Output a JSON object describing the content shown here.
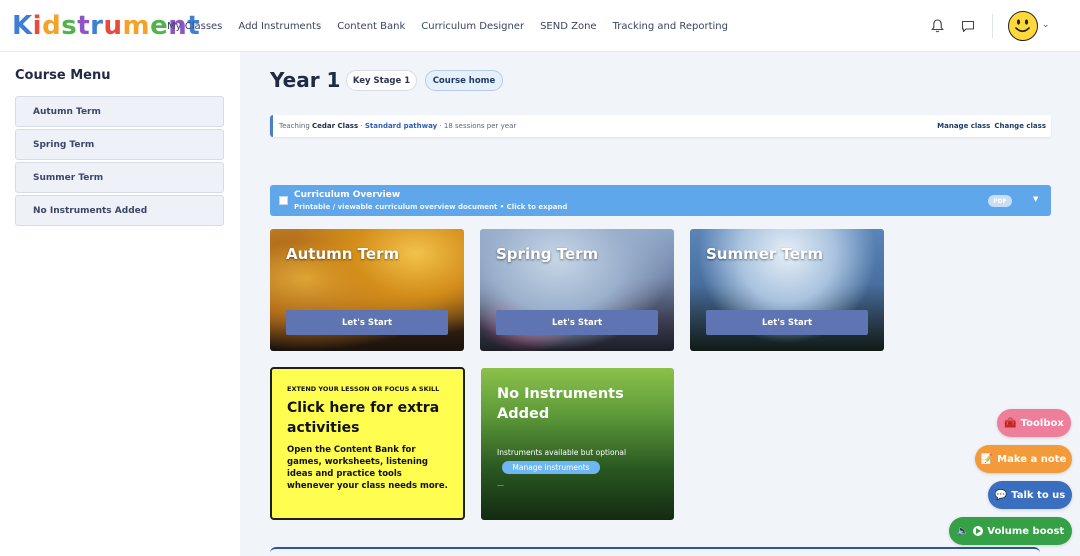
{
  "brand": {
    "logo_letters": [
      "K",
      "i",
      "d",
      "s",
      "t",
      "r",
      "u",
      "m",
      "e",
      "n",
      "t"
    ],
    "logo_colors": [
      "#3f7fd3",
      "#e64b3c",
      "#f4a228",
      "#53b24c",
      "#8f55c7",
      "#3f7fd3",
      "#e64b3c",
      "#f4a228",
      "#53b24c",
      "#8f55c7",
      "#3f7fd3"
    ]
  },
  "nav": {
    "items": [
      "My Classes",
      "Add Instruments",
      "Content Bank",
      "Curriculum Designer",
      "SEND Zone",
      "Tracking and Reporting"
    ]
  },
  "header_icons": {
    "notifications": "bell-icon",
    "messages": "chat-icon",
    "avatar": "smiley-avatar",
    "chevron": "⌄"
  },
  "sidebar": {
    "title": "Course Menu",
    "items": [
      {
        "label": "Autumn Term"
      },
      {
        "label": "Spring Term"
      },
      {
        "label": "Summer Term"
      },
      {
        "label": "No Instruments Added"
      }
    ]
  },
  "page": {
    "title": "Year 1",
    "key_stage": "Key Stage 1",
    "course_home": "Course home"
  },
  "teaching": {
    "prefix": "Teaching",
    "class_name": "Cedar Class",
    "sep1": "·",
    "pathway": "Standard pathway",
    "sessions": "· 18 sessions per year",
    "manage": "Manage class",
    "change": "Change class"
  },
  "overview": {
    "title": "Curriculum Overview",
    "subtitle": "Printable / viewable curriculum overview document • Click to expand",
    "badge": "PDF",
    "chevron": "▼"
  },
  "terms": [
    {
      "title": "Autumn Term",
      "button": "Let's Start"
    },
    {
      "title": "Spring Term",
      "button": "Let's Start"
    },
    {
      "title": "Summer Term",
      "button": "Let's Start"
    }
  ],
  "extra": {
    "kicker": "EXTEND YOUR LESSON OR FOCUS A SKILL",
    "title": "Click here for extra activities",
    "body": "Open the Content Bank for games, worksheets, listening ideas and practice tools whenever your class needs more."
  },
  "no_instruments": {
    "title": "No Instruments Added",
    "line": "Instruments available but optional",
    "button": "Manage instruments",
    "dash": "—"
  },
  "fabs": {
    "toolbox": "Toolbox",
    "note": "Make a note",
    "talk": "Talk to us",
    "volume": "Volume boost"
  },
  "colors": {
    "primary": "#1f2a44",
    "accent_blue": "#5fa7ea",
    "button_blue": "#5f74b2",
    "extra_yellow": "#fffd4f",
    "toolbox_pink": "#ef7e9b",
    "note_orange": "#f39a3a",
    "talk_blue": "#3a6ebf",
    "volume_green": "#35a046"
  }
}
